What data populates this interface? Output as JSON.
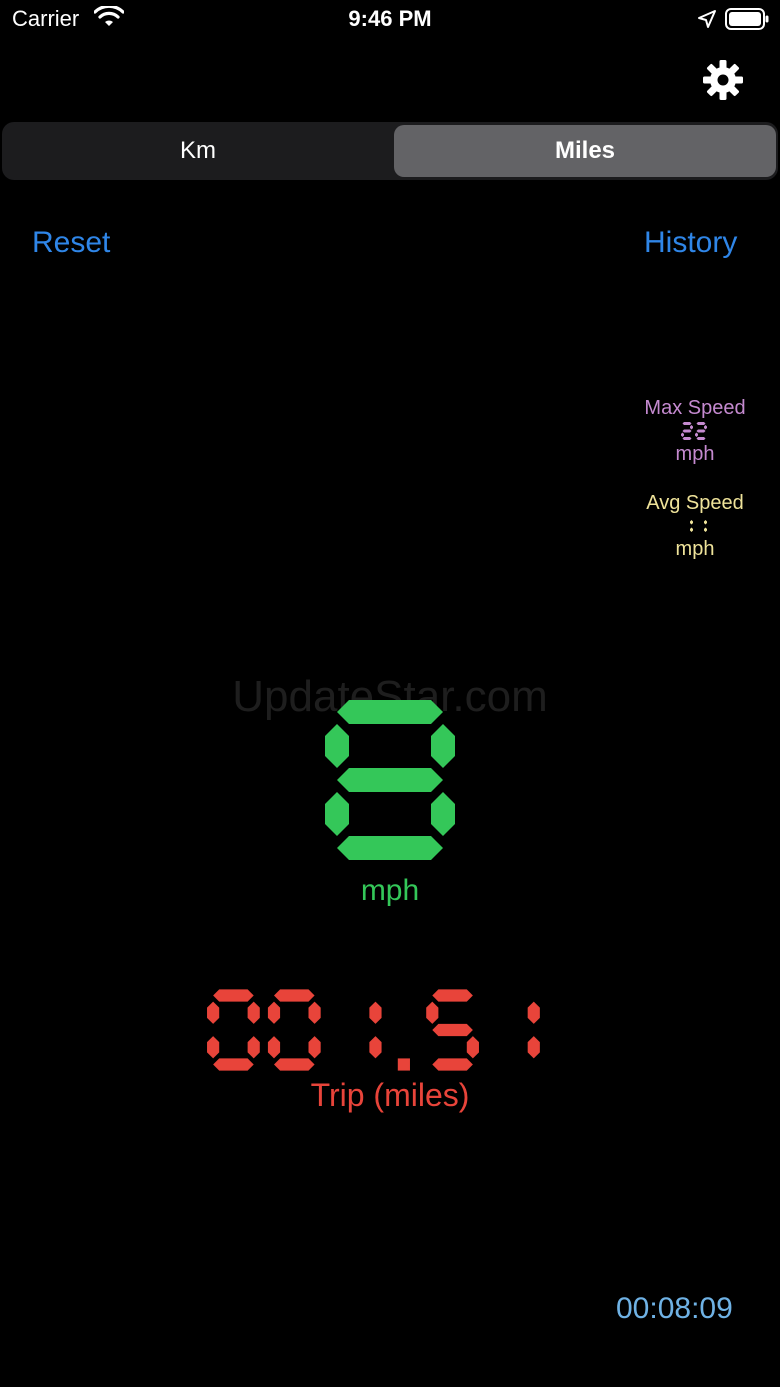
{
  "status_bar": {
    "carrier": "Carrier",
    "time": "9:46 PM"
  },
  "header": {
    "settings_icon": "gear-icon"
  },
  "unit_toggle": {
    "options": [
      "Km",
      "Miles"
    ],
    "selected": "Miles"
  },
  "actions": {
    "reset_label": "Reset",
    "history_label": "History"
  },
  "max_speed": {
    "label": "Max Speed",
    "value": "22",
    "unit": "mph"
  },
  "avg_speed": {
    "label": "Avg Speed",
    "value": "11",
    "unit": "mph"
  },
  "watermark": "UpdateStar.com",
  "speed": {
    "value": "8",
    "unit": "mph"
  },
  "trip": {
    "value": "001.51",
    "label": "Trip (miles)"
  },
  "elapsed": "00:08:09",
  "colors": {
    "accent": "#2f86e8",
    "speed": "#34c759",
    "trip": "#e8443a",
    "max": "#c58ad0",
    "avg": "#efe39a",
    "timer": "#6fb2e5"
  }
}
